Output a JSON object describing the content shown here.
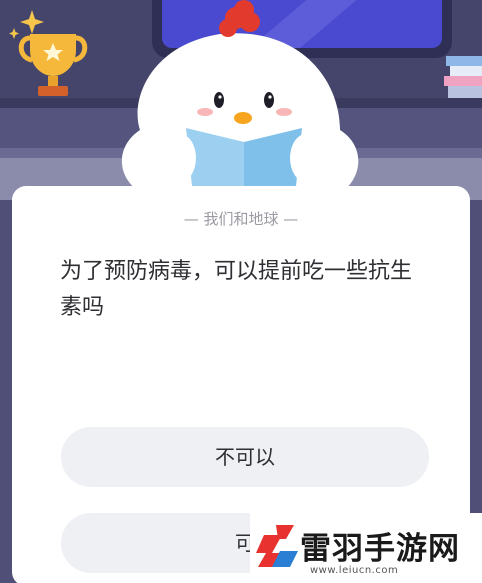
{
  "category": "— 我们和地球 —",
  "question": "为了预防病毒，可以提前吃一些抗生素吗",
  "answers": [
    {
      "label": "不可以"
    },
    {
      "label": "可"
    }
  ],
  "watermark": {
    "name": "雷羽手游网",
    "url": "www.leiucn.com"
  },
  "colors": {
    "background": "#4f4f78",
    "card": "#ffffff",
    "answer_bg": "#eef0f3",
    "brand_red": "#e8322f",
    "brand_blue": "#2a7fd4"
  },
  "icons": [
    "sparkle-icon",
    "trophy-icon",
    "chick-mascot",
    "book-stack-icon",
    "brand-logo-icon"
  ]
}
